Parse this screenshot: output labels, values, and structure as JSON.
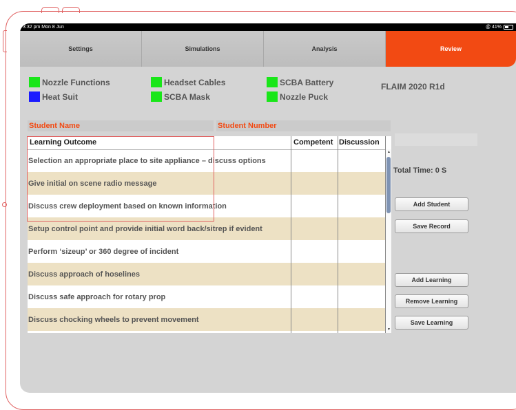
{
  "status_bar": {
    "time": "3:32 pm  Mon 8 Jun",
    "signal": "@ 41%"
  },
  "tabs": [
    {
      "label": "Settings"
    },
    {
      "label": "Simulations"
    },
    {
      "label": "Analysis"
    },
    {
      "label": "Review"
    }
  ],
  "device_status": [
    {
      "label": "Nozzle Functions",
      "color": "#19e619"
    },
    {
      "label": "Headset Cables",
      "color": "#19e619"
    },
    {
      "label": "SCBA Battery",
      "color": "#19e619"
    },
    {
      "label": "Heat Suit",
      "color": "#1a1aff"
    },
    {
      "label": "SCBA Mask",
      "color": "#19e619"
    },
    {
      "label": "Nozzle Puck",
      "color": "#19e619"
    }
  ],
  "app_version": "FLAIM 2020 R1d",
  "student": {
    "name_label": "Student Name",
    "number_label": "Student Number"
  },
  "table": {
    "headers": [
      "Learning Outcome",
      "Competent",
      "Discussion"
    ],
    "rows": [
      "Selection an appropriate place to site appliance – discuss options",
      "Give initial on scene radio message",
      "Discuss crew deployment based on known information",
      "Setup control point and provide initial word back/sitrep if evident",
      "Perform ‘sizeup’ or 360 degree of incident",
      "Discuss approach of hoselines",
      "Discuss safe approach for rotary prop",
      "Discuss chocking wheels to prevent movement"
    ]
  },
  "total_time": "Total Time: 0 S",
  "buttons": {
    "add_student": "Add Student",
    "save_record": "Save Record",
    "add_learning": "Add Learning",
    "remove_learning": "Remove Learning",
    "save_learning": "Save Learning"
  },
  "colors": {
    "accent": "#f24a13",
    "row_alt": "#ede1c4",
    "ok": "#19e619",
    "info": "#1a1aff"
  }
}
